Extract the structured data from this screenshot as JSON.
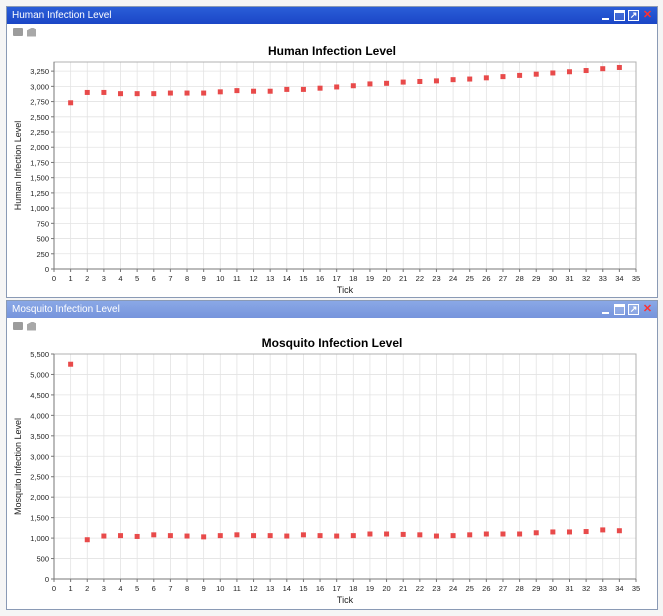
{
  "windows": [
    {
      "title": "Human Infection Level"
    },
    {
      "title": "Mosquito Infection Level"
    }
  ],
  "icons": [
    "minimize-icon",
    "maximize-icon",
    "detach-icon",
    "close-icon"
  ],
  "colors": {
    "marker": "#e84a4a",
    "active_titlebar": "#1b46c6",
    "inactive_titlebar": "#7694dc",
    "grid": "#e3e3e3"
  },
  "chart_data": [
    {
      "type": "scatter",
      "title": "Human Infection Level",
      "xlabel": "Tick",
      "ylabel": "Human Infection Level",
      "xlim": [
        0,
        35
      ],
      "ylim": [
        0,
        3400
      ],
      "xticks": [
        0,
        1,
        2,
        3,
        4,
        5,
        6,
        7,
        8,
        9,
        10,
        11,
        12,
        13,
        14,
        15,
        16,
        17,
        18,
        19,
        20,
        21,
        22,
        23,
        24,
        25,
        26,
        27,
        28,
        29,
        30,
        31,
        32,
        33,
        34,
        35
      ],
      "yticks": [
        0,
        250,
        500,
        750,
        1000,
        1250,
        1500,
        1750,
        2000,
        2250,
        2500,
        2750,
        3000,
        3250
      ],
      "ytick_labels": [
        "0",
        "250",
        "500",
        "750",
        "1,000",
        "1,250",
        "1,500",
        "1,750",
        "2,000",
        "2,250",
        "2,500",
        "2,750",
        "3,000",
        "3,250"
      ],
      "grid": true,
      "series": [
        {
          "x": [
            1,
            2,
            3,
            4,
            5,
            6,
            7,
            8,
            9,
            10,
            11,
            12,
            13,
            14,
            15,
            16,
            17,
            18,
            19,
            20,
            21,
            22,
            23,
            24,
            25,
            26,
            27,
            28,
            29,
            30,
            31,
            32,
            33,
            34
          ],
          "y": [
            2730,
            2900,
            2900,
            2880,
            2880,
            2880,
            2890,
            2890,
            2890,
            2910,
            2930,
            2920,
            2920,
            2950,
            2950,
            2970,
            2990,
            3010,
            3040,
            3050,
            3070,
            3080,
            3090,
            3110,
            3120,
            3140,
            3160,
            3180,
            3200,
            3220,
            3240,
            3260,
            3290,
            3310
          ]
        }
      ]
    },
    {
      "type": "scatter",
      "title": "Mosquito Infection Level",
      "xlabel": "Tick",
      "ylabel": "Mosquito Infection Level",
      "xlim": [
        0,
        35
      ],
      "ylim": [
        0,
        5500
      ],
      "xticks": [
        0,
        1,
        2,
        3,
        4,
        5,
        6,
        7,
        8,
        9,
        10,
        11,
        12,
        13,
        14,
        15,
        16,
        17,
        18,
        19,
        20,
        21,
        22,
        23,
        24,
        25,
        26,
        27,
        28,
        29,
        30,
        31,
        32,
        33,
        34,
        35
      ],
      "yticks": [
        0,
        500,
        1000,
        1500,
        2000,
        2500,
        3000,
        3500,
        4000,
        4500,
        5000,
        5500
      ],
      "ytick_labels": [
        "0",
        "500",
        "1,000",
        "1,500",
        "2,000",
        "2,500",
        "3,000",
        "3,500",
        "4,000",
        "4,500",
        "5,000",
        "5,500"
      ],
      "grid": true,
      "series": [
        {
          "x": [
            1,
            2,
            3,
            4,
            5,
            6,
            7,
            8,
            9,
            10,
            11,
            12,
            13,
            14,
            15,
            16,
            17,
            18,
            19,
            20,
            21,
            22,
            23,
            24,
            25,
            26,
            27,
            28,
            29,
            30,
            31,
            32,
            33,
            34
          ],
          "y": [
            5250,
            960,
            1050,
            1060,
            1040,
            1080,
            1060,
            1050,
            1030,
            1060,
            1080,
            1060,
            1060,
            1050,
            1080,
            1060,
            1050,
            1060,
            1100,
            1100,
            1090,
            1080,
            1050,
            1060,
            1080,
            1100,
            1100,
            1100,
            1130,
            1150,
            1150,
            1160,
            1200,
            1180
          ]
        }
      ]
    }
  ]
}
